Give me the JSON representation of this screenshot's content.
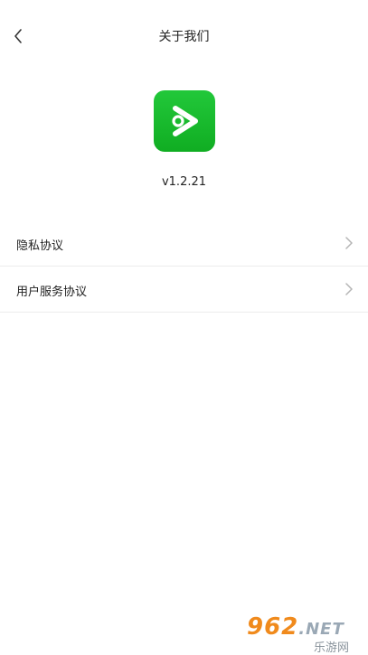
{
  "header": {
    "title": "关于我们"
  },
  "app": {
    "version": "v1.2.21"
  },
  "menu": [
    {
      "label": "隐私协议"
    },
    {
      "label": "用户服务协议"
    }
  ],
  "watermark": {
    "brand": "962",
    "suffix": ".NET",
    "subtitle": "乐游网"
  },
  "colors": {
    "logo_green": "#1bbf31",
    "divider": "#ececec",
    "watermark_orange": "#f08a1c"
  },
  "icons": {
    "back": "chevron-left-icon",
    "logo": "app-logo-icon",
    "row": "chevron-right-icon"
  }
}
